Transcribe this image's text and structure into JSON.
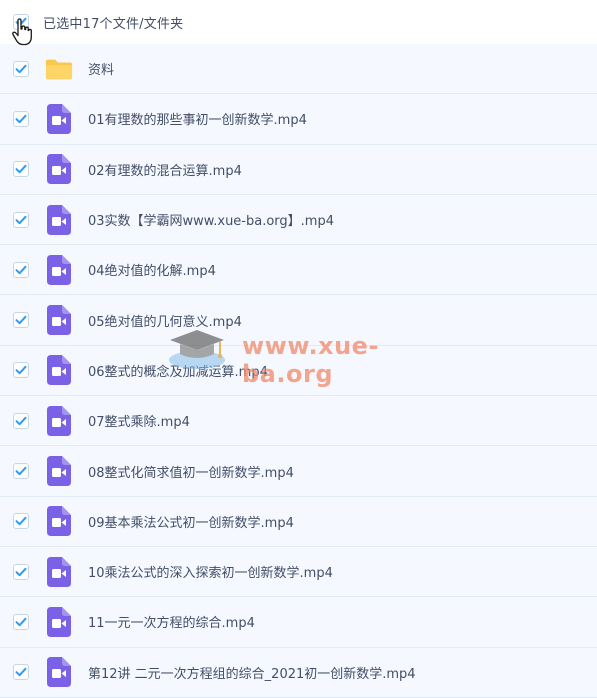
{
  "header": {
    "selection_text": "已选中17个文件/文件夹"
  },
  "colors": {
    "accent": "#2e9af0",
    "video_icon": "#7b61e6",
    "folder": "#fbc84b",
    "row_bg": "#f5f9ff"
  },
  "files": [
    {
      "name": "资料",
      "type": "folder",
      "icon": "folder-icon"
    },
    {
      "name": "01有理数的那些事初一创新数学.mp4",
      "type": "video",
      "icon": "video-file-icon"
    },
    {
      "name": "02有理数的混合运算.mp4",
      "type": "video",
      "icon": "video-file-icon"
    },
    {
      "name": "03实数【学霸网www.xue-ba.org】.mp4",
      "type": "video",
      "icon": "video-file-icon"
    },
    {
      "name": "04绝对值的化解.mp4",
      "type": "video",
      "icon": "video-file-icon"
    },
    {
      "name": "05绝对值的几何意义.mp4",
      "type": "video",
      "icon": "video-file-icon"
    },
    {
      "name": "06整式的概念及加减运算.mp4",
      "type": "video",
      "icon": "video-file-icon"
    },
    {
      "name": "07整式乘除.mp4",
      "type": "video",
      "icon": "video-file-icon"
    },
    {
      "name": "08整式化简求值初一创新数学.mp4",
      "type": "video",
      "icon": "video-file-icon"
    },
    {
      "name": "09基本乘法公式初一创新数学.mp4",
      "type": "video",
      "icon": "video-file-icon"
    },
    {
      "name": "10乘法公式的深入探索初一创新数学.mp4",
      "type": "video",
      "icon": "video-file-icon"
    },
    {
      "name": "11一元一次方程的综合.mp4",
      "type": "video",
      "icon": "video-file-icon"
    },
    {
      "name": "第12讲 二元一次方程组的综合_2021初一创新数学.mp4",
      "type": "video",
      "icon": "video-file-icon"
    }
  ],
  "watermark": {
    "text": "www.xue-ba.org"
  }
}
